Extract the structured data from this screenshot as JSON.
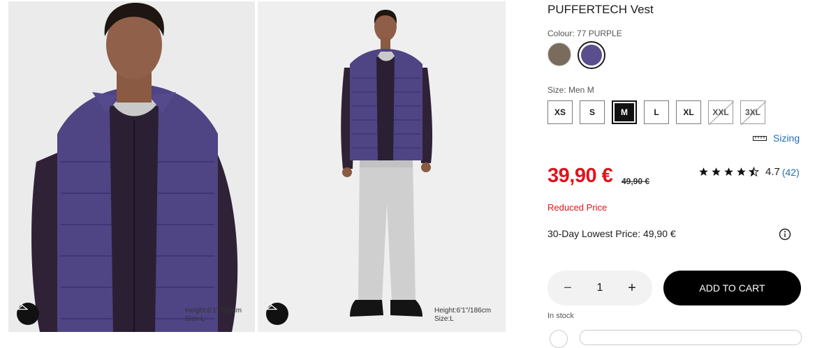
{
  "product": {
    "title": "PUFFERTECH Vest"
  },
  "photos": [
    {
      "model_height": "Height:6'1\"/186cm",
      "model_size": "Size:L"
    },
    {
      "model_height": "Height:6'1\"/186cm",
      "model_size": "Size:L"
    }
  ],
  "colour": {
    "label": "Colour: 77 PURPLE",
    "swatches": [
      {
        "name": "brown",
        "color": "#7a6c5d",
        "selected": false
      },
      {
        "name": "purple",
        "color": "#5b4e8e",
        "selected": true
      }
    ]
  },
  "size": {
    "label": "Size: Men M",
    "options": [
      {
        "label": "XS",
        "state": "available"
      },
      {
        "label": "S",
        "state": "available"
      },
      {
        "label": "M",
        "state": "selected"
      },
      {
        "label": "L",
        "state": "available"
      },
      {
        "label": "XL",
        "state": "available"
      },
      {
        "label": "XXL",
        "state": "unavailable"
      },
      {
        "label": "3XL",
        "state": "unavailable"
      }
    ],
    "sizing_link": "Sizing"
  },
  "pricing": {
    "price": "39,90 €",
    "old_price": "49,90 €",
    "reduced_label": "Reduced Price",
    "lowest_price": "30-Day Lowest Price: 49,90 €",
    "accent_color": "#e2131c"
  },
  "rating": {
    "value": "4.7",
    "count": "(42)",
    "stars": 4.5
  },
  "cart": {
    "quantity": "1",
    "minus": "−",
    "plus": "+",
    "add_label": "ADD TO CART",
    "stock_text": "In stock"
  }
}
